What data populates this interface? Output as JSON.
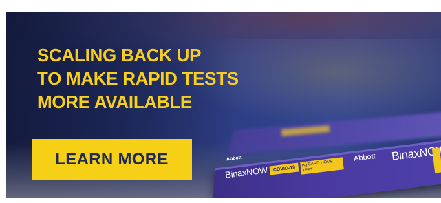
{
  "headline": {
    "line1": "SCALING BACK UP",
    "line2": "TO MAKE RAPID TESTS",
    "line3": "MORE AVAILABLE"
  },
  "cta": {
    "label": "LEARN MORE"
  },
  "product": {
    "brand_small": "Abbott",
    "name_left": "BinaxNOW",
    "covid_tag": "COVID-19",
    "card_tag": "Ag CARD HOME TEST",
    "brand_logo": "Abbott",
    "name_right": "BinaxNOW"
  },
  "colors": {
    "accent_yellow": "#f7cf1c",
    "button_yellow": "#f6cf17",
    "button_text": "#1f2a54",
    "background_navy": "#23306a",
    "box_purple": "#4a3aa0"
  }
}
